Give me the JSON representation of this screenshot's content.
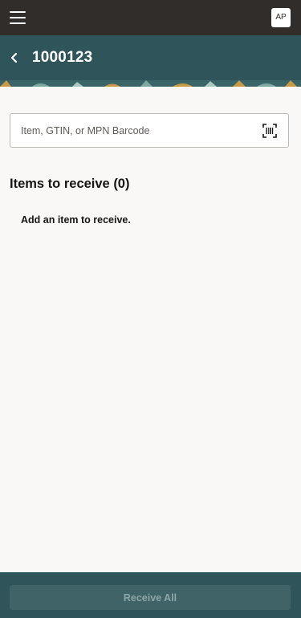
{
  "header": {
    "menu_icon": "hamburger-menu-icon",
    "avatar_initials": "AP"
  },
  "titlebar": {
    "back_icon": "chevron-left-icon",
    "title": "1000123"
  },
  "search": {
    "placeholder": "Item, GTIN, or MPN Barcode",
    "value": "",
    "scan_icon": "barcode-scan-icon"
  },
  "items": {
    "heading": "Items to receive (0)",
    "empty_message": "Add an item to receive."
  },
  "footer": {
    "receive_all_label": "Receive All"
  },
  "colors": {
    "topbar": "#312d2a",
    "accent": "#2f5459",
    "background": "#f9f8f6"
  }
}
